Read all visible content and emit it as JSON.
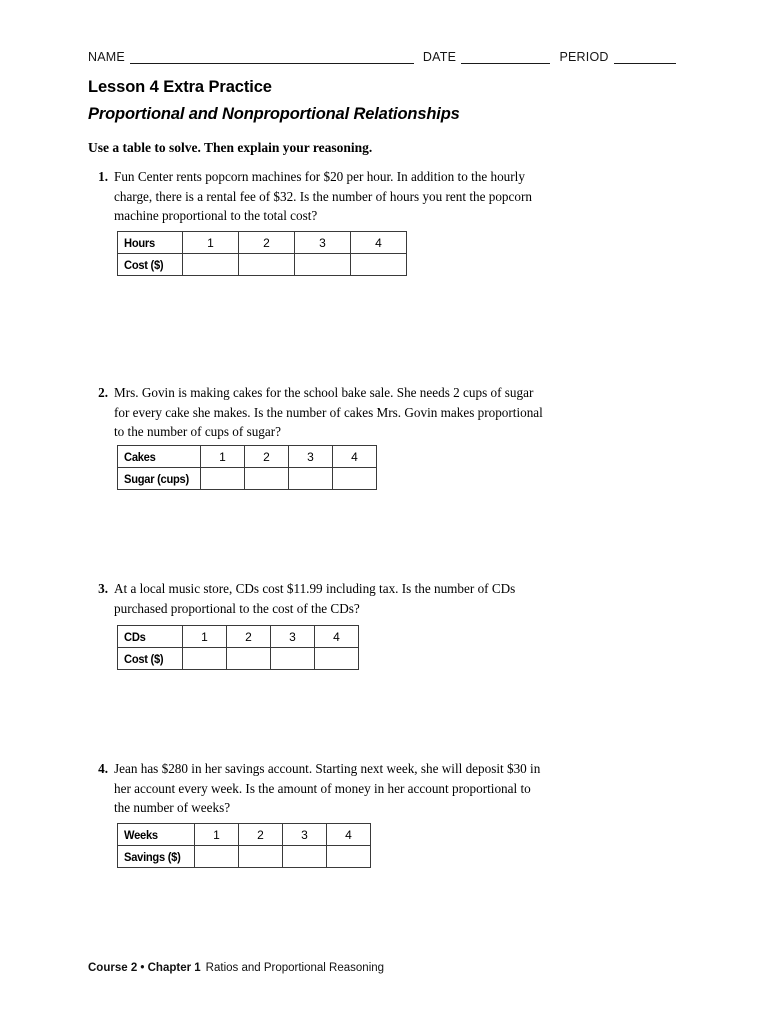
{
  "header": {
    "name_label": "NAME",
    "date_label": "DATE",
    "period_label": "PERIOD"
  },
  "titles": {
    "lesson": "Lesson 4 Extra Practice",
    "subtitle": "Proportional and Nonproportional Relationships",
    "directions": "Use a table to solve. Then explain your reasoning."
  },
  "problems": [
    {
      "number": "1.",
      "text": "Fun Center rents popcorn machines for $20 per hour. In addition to the hourly charge, there is a rental fee of $32. Is the number of hours you rent the popcorn machine proportional to the total cost?",
      "table": {
        "row_labels": [
          "Hours",
          "Cost ($)"
        ],
        "values": [
          "1",
          "2",
          "3",
          "4"
        ],
        "answers": [
          "",
          "",
          "",
          ""
        ]
      }
    },
    {
      "number": "2.",
      "text": "Mrs. Govin is making cakes for the school bake sale. She needs 2 cups of sugar for every cake she makes. Is the number of cakes Mrs. Govin makes proportional to the number of cups of sugar?",
      "table": {
        "row_labels": [
          "Cakes",
          "Sugar (cups)"
        ],
        "values": [
          "1",
          "2",
          "3",
          "4"
        ],
        "answers": [
          "",
          "",
          "",
          ""
        ]
      }
    },
    {
      "number": "3.",
      "text": "At a local music store, CDs cost $11.99 including tax. Is the number of CDs purchased proportional to the cost of the CDs?",
      "table": {
        "row_labels": [
          "CDs",
          "Cost ($)"
        ],
        "values": [
          "1",
          "2",
          "3",
          "4"
        ],
        "answers": [
          "",
          "",
          "",
          ""
        ]
      }
    },
    {
      "number": "4.",
      "text": "Jean has $280 in her savings account. Starting next week, she will deposit $30 in her account every week. Is the amount of money in her account proportional to the number of weeks?",
      "table": {
        "row_labels": [
          "Weeks",
          "Savings ($)"
        ],
        "values": [
          "1",
          "2",
          "3",
          "4"
        ],
        "answers": [
          "",
          "",
          "",
          ""
        ]
      }
    }
  ],
  "footer": {
    "course_chapter": "Course 2 • Chapter 1",
    "topic": "Ratios and Proportional Reasoning"
  }
}
